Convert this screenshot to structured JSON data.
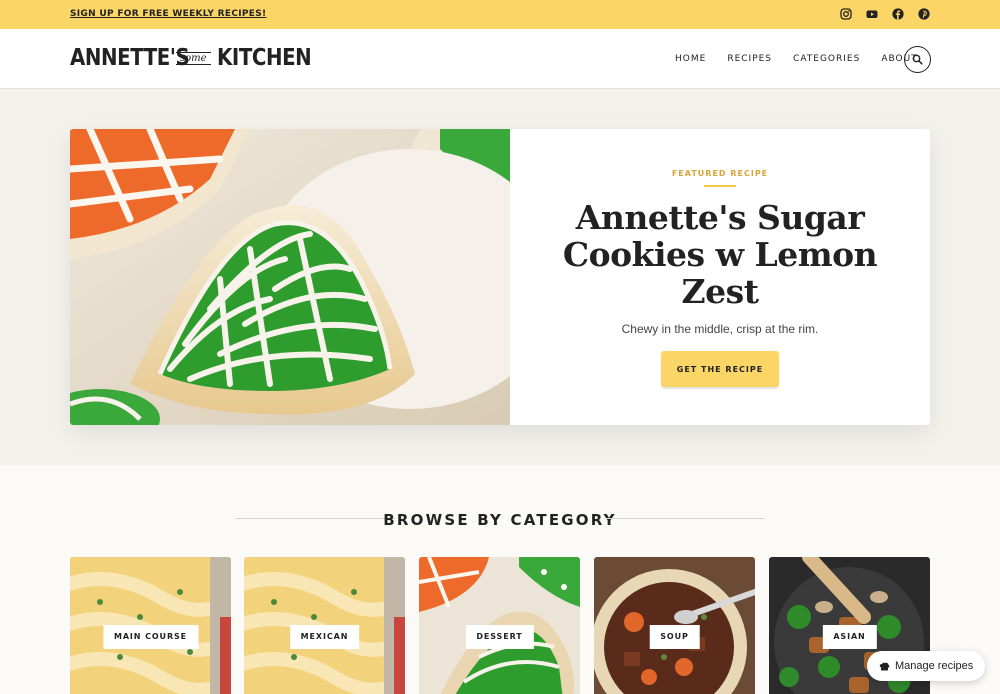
{
  "topbar": {
    "signup_text": "SIGN UP FOR FREE WEEKLY RECIPES!",
    "social_icons": [
      "instagram-icon",
      "youtube-icon",
      "facebook-icon",
      "pinterest-icon"
    ],
    "background": "#fbd565"
  },
  "header": {
    "logo_left": "ANNETTE'S",
    "logo_middle": "some",
    "logo_right": "KITCHEN",
    "nav": [
      "HOME",
      "RECIPES",
      "CATEGORIES",
      "ABOUT"
    ],
    "search_icon": "search-icon"
  },
  "hero": {
    "eyebrow": "FEATURED RECIPE",
    "title": "Annette's Sugar Cookies w Lemon Zest",
    "subtitle": "Chewy in the middle, crisp at the rim.",
    "button": "GET THE RECIPE",
    "accent": "#d8a53a"
  },
  "browse": {
    "title": "BROWSE BY CATEGORY",
    "categories": [
      {
        "label": "MAIN COURSE"
      },
      {
        "label": "MEXICAN"
      },
      {
        "label": "DESSERT"
      },
      {
        "label": "SOUP"
      },
      {
        "label": "ASIAN"
      }
    ]
  },
  "manage": {
    "label": "Manage recipes",
    "icon": "chef-hat-icon"
  }
}
